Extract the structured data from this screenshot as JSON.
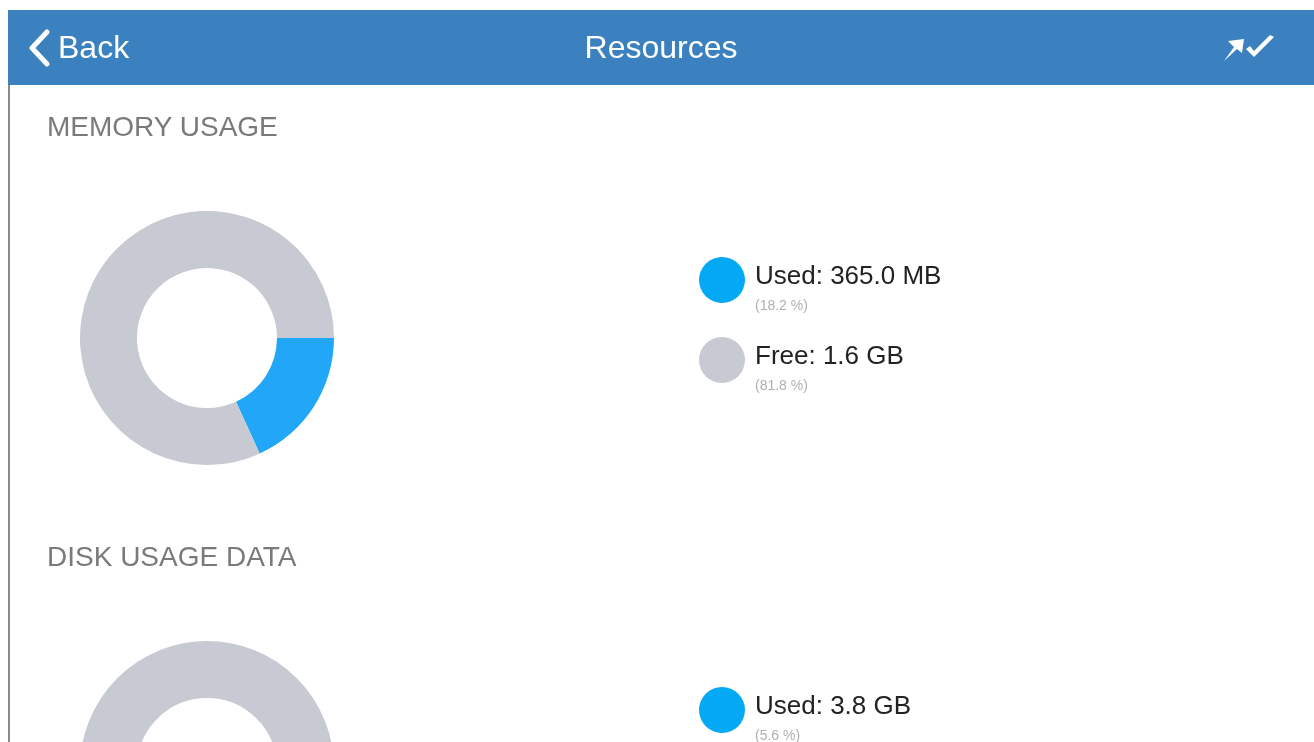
{
  "nav_bar": {
    "back_label": "Back",
    "title": "Resources"
  },
  "sections": [
    {
      "title": "MEMORY USAGE",
      "legend": [
        {
          "label": "Used: 365.0 MB",
          "percent": "(18.2 %)",
          "color": "#03a9f4"
        },
        {
          "label": "Free: 1.6 GB",
          "percent": "(81.8 %)",
          "color": "#c8cad3"
        }
      ],
      "chart_data": {
        "type": "donut",
        "values": [
          18.2,
          81.8
        ]
      }
    },
    {
      "title": "DISK USAGE DATA",
      "legend": [
        {
          "label": "Used: 3.8 GB",
          "percent": "(5.6 %)",
          "color": "#03a9f4"
        }
      ]
    }
  ]
}
